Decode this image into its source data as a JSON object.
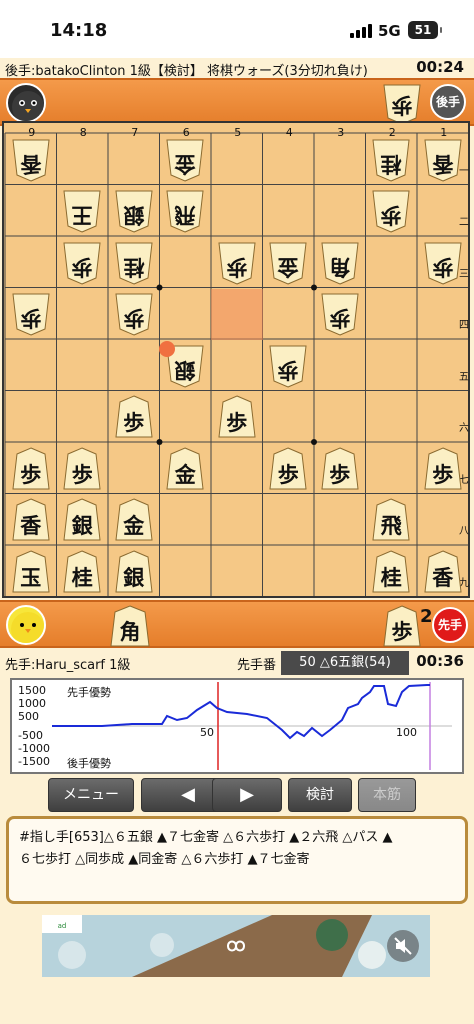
{
  "status_bar": {
    "time": "14:18",
    "network": "5G",
    "battery": "51"
  },
  "gote_info": {
    "text": "後手:batakoClinton 1級【検討】 将棋ウォーズ(3分切れ負け)",
    "clock": "00:24"
  },
  "gote_hand": {
    "turn_badge": "後手",
    "pieces": [
      {
        "kanji": "歩",
        "count": ""
      }
    ]
  },
  "board": {
    "col_labels": [
      "9",
      "8",
      "7",
      "6",
      "5",
      "4",
      "3",
      "2",
      "1"
    ],
    "row_labels": [
      "一",
      "二",
      "三",
      "四",
      "五",
      "六",
      "七",
      "八",
      "九"
    ],
    "pieces": [
      {
        "col": 9,
        "row": 1,
        "kanji": "香",
        "side": "gote"
      },
      {
        "col": 6,
        "row": 1,
        "kanji": "金",
        "side": "gote"
      },
      {
        "col": 2,
        "row": 1,
        "kanji": "桂",
        "side": "gote"
      },
      {
        "col": 1,
        "row": 1,
        "kanji": "香",
        "side": "gote"
      },
      {
        "col": 8,
        "row": 2,
        "kanji": "王",
        "side": "gote"
      },
      {
        "col": 7,
        "row": 2,
        "kanji": "銀",
        "side": "gote"
      },
      {
        "col": 6,
        "row": 2,
        "kanji": "飛",
        "side": "gote"
      },
      {
        "col": 2,
        "row": 2,
        "kanji": "歩",
        "side": "gote"
      },
      {
        "col": 8,
        "row": 3,
        "kanji": "歩",
        "side": "gote"
      },
      {
        "col": 7,
        "row": 3,
        "kanji": "桂",
        "side": "gote"
      },
      {
        "col": 5,
        "row": 3,
        "kanji": "歩",
        "side": "gote"
      },
      {
        "col": 4,
        "row": 3,
        "kanji": "金",
        "side": "gote"
      },
      {
        "col": 3,
        "row": 3,
        "kanji": "角",
        "side": "gote"
      },
      {
        "col": 1,
        "row": 3,
        "kanji": "歩",
        "side": "gote"
      },
      {
        "col": 9,
        "row": 4,
        "kanji": "歩",
        "side": "gote"
      },
      {
        "col": 7,
        "row": 4,
        "kanji": "歩",
        "side": "gote"
      },
      {
        "col": 3,
        "row": 4,
        "kanji": "歩",
        "side": "gote"
      },
      {
        "col": 6,
        "row": 5,
        "kanji": "銀",
        "side": "gote"
      },
      {
        "col": 4,
        "row": 5,
        "kanji": "歩",
        "side": "gote"
      },
      {
        "col": 7,
        "row": 6,
        "kanji": "歩",
        "side": "sente"
      },
      {
        "col": 5,
        "row": 6,
        "kanji": "歩",
        "side": "sente"
      },
      {
        "col": 9,
        "row": 7,
        "kanji": "歩",
        "side": "sente"
      },
      {
        "col": 8,
        "row": 7,
        "kanji": "歩",
        "side": "sente"
      },
      {
        "col": 6,
        "row": 7,
        "kanji": "金",
        "side": "sente"
      },
      {
        "col": 4,
        "row": 7,
        "kanji": "歩",
        "side": "sente"
      },
      {
        "col": 3,
        "row": 7,
        "kanji": "歩",
        "side": "sente"
      },
      {
        "col": 1,
        "row": 7,
        "kanji": "歩",
        "side": "sente"
      },
      {
        "col": 9,
        "row": 8,
        "kanji": "香",
        "side": "sente"
      },
      {
        "col": 8,
        "row": 8,
        "kanji": "銀",
        "side": "sente"
      },
      {
        "col": 7,
        "row": 8,
        "kanji": "金",
        "side": "sente"
      },
      {
        "col": 2,
        "row": 8,
        "kanji": "飛",
        "side": "sente"
      },
      {
        "col": 9,
        "row": 9,
        "kanji": "玉",
        "side": "sente"
      },
      {
        "col": 8,
        "row": 9,
        "kanji": "桂",
        "side": "sente"
      },
      {
        "col": 7,
        "row": 9,
        "kanji": "銀",
        "side": "sente"
      },
      {
        "col": 2,
        "row": 9,
        "kanji": "桂",
        "side": "sente"
      },
      {
        "col": 1,
        "row": 9,
        "kanji": "香",
        "side": "sente"
      }
    ],
    "highlight": {
      "col": 5,
      "row": 4
    },
    "last_move": {
      "col": 6,
      "row": 5
    }
  },
  "sente_hand": {
    "turn_badge": "先手",
    "pieces": [
      {
        "kanji": "角",
        "count": ""
      },
      {
        "kanji": "歩",
        "count": "2"
      }
    ]
  },
  "sente_info": {
    "text": "先手:Haru_scarf 1級",
    "turn_label": "先手番",
    "move": "50 △6五銀(54)",
    "clock": "00:36"
  },
  "graph": {
    "y_labels": [
      "1500",
      "1000",
      "500",
      "-500",
      "-1000",
      "-1500"
    ],
    "sente_label": "先手優勢",
    "gote_label": "後手優勢",
    "x_labels": [
      "50",
      "100"
    ]
  },
  "buttons": {
    "menu": "メニュー",
    "prev": "◀",
    "next": "▶",
    "analyze": "検討",
    "main_line": "本筋"
  },
  "kifu": {
    "line1": "#指し手[653]△６五銀 ▲７七金寄 △６六歩打 ▲２六飛 △パス ▲",
    "line2": "６七歩打 △同歩成 ▲同金寄 △６六歩打 ▲７七金寄"
  }
}
